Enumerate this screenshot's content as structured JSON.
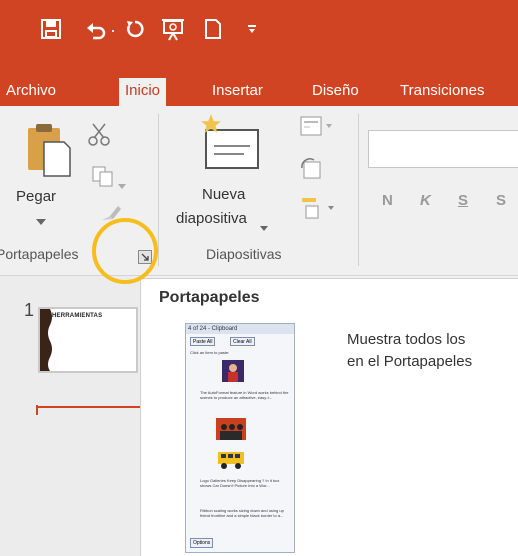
{
  "quick_access": {
    "save_icon": "save-icon",
    "undo_icon": "undo-icon",
    "redo_icon": "redo-icon",
    "present_icon": "present-icon",
    "new_icon": "new-document-icon",
    "customize_icon": "customize-icon",
    "undo_arrow": "·"
  },
  "tabs": [
    {
      "label": "Archivo"
    },
    {
      "label": "Inicio",
      "active": true
    },
    {
      "label": "Insertar"
    },
    {
      "label": "Diseño"
    },
    {
      "label": "Transiciones"
    }
  ],
  "ribbon": {
    "clipboard": {
      "paste_label": "Pegar",
      "group_label": "Portapapeles"
    },
    "slides": {
      "new_slide_line1": "Nueva",
      "new_slide_line2": "diapositiva",
      "group_label": "Diapositivas"
    },
    "font": {
      "bold": "N",
      "italic": "K",
      "underline": "S",
      "strike": "S"
    }
  },
  "slides_pane": {
    "slide_number": "1",
    "slide_title": "HERRAMIENTAS"
  },
  "tooltip": {
    "title": "Portapapeles",
    "description_line1": "Muestra todos los",
    "description_line2": "en el Portapapeles",
    "preview": {
      "header": "4 of 24 - Clipboard",
      "paste_all": "Paste All",
      "clear_all": "Clear All",
      "hint": "Click an item to paste:",
      "item_text_1": "The AutoFormat feature in Word works behind the scenes to produce an attractive, easy-t...",
      "item_text_2": "Logo Galleries Keep Disappearing ? In it box shows Car Doesn't Picture Into a Wor...",
      "item_text_3": "Ribbon scaling works sizing down and using up friend frontline and a simple black border to a...",
      "options": "Options"
    }
  },
  "colors": {
    "accent": "#d04423",
    "highlight": "#f5be1c"
  }
}
